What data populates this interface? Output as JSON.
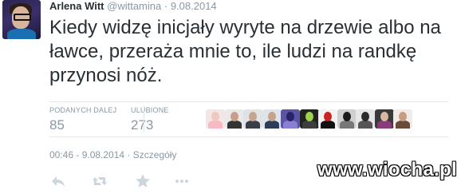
{
  "tweet": {
    "author_name": "Arlena Witt",
    "author_handle": "@wittamina",
    "separator": "·",
    "date": "9.08.2014",
    "text": "Kiedy widzę inicjały wyryte na drzewie albo na ławce, przeraża mnie to, ile ludzi na randkę przynosi nóż."
  },
  "stats": {
    "retweets_label": "PODANYCH DALEJ",
    "retweets_count": "85",
    "favorites_label": "ULUBIONE",
    "favorites_count": "273"
  },
  "favoriters": [
    {
      "name": "favoriter-avatar-1",
      "bg": "#f3e6e6",
      "head": "#f0c8c0",
      "body": "#f7b9c4"
    },
    {
      "name": "favoriter-avatar-2",
      "bg": "#e9e9e9",
      "head": "#c79f86",
      "body": "#333333"
    },
    {
      "name": "favoriter-avatar-3",
      "bg": "#dfe3e7",
      "head": "#c9a48d",
      "body": "#3a3f47"
    },
    {
      "name": "favoriter-avatar-4",
      "bg": "#dde4ea",
      "head": "#c8a28a",
      "body": "#2c3e57"
    },
    {
      "name": "favoriter-avatar-5",
      "bg": "#5b55a5",
      "head": "#2a2366",
      "body": "#8b7fd4"
    },
    {
      "name": "favoriter-avatar-6",
      "bg": "#222222",
      "head": "#9fd24b",
      "body": "#3d3d3d"
    },
    {
      "name": "favoriter-avatar-7",
      "bg": "#f2f2f2",
      "head": "#cc2222",
      "body": "#111111"
    },
    {
      "name": "favoriter-avatar-8",
      "bg": "#cfcfcf",
      "head": "#1a1a1a",
      "body": "#777777"
    },
    {
      "name": "favoriter-avatar-9",
      "bg": "#e6e6e6",
      "head": "#2b2b2b",
      "body": "#555555"
    },
    {
      "name": "favoriter-avatar-10",
      "bg": "#3a3a3a",
      "head": "#d9b8a2",
      "body": "#8a3b7a"
    },
    {
      "name": "favoriter-avatar-11",
      "bg": "#f0ebe8",
      "head": "#c99c82",
      "body": "#6b4a3a"
    }
  ],
  "footer": {
    "time": "00:46 - 9.08.2014",
    "separator": "·",
    "details_link": "Szczegóły"
  },
  "watermark": {
    "text": "www.wiocha.pl"
  },
  "icons": [
    "reply-icon",
    "retweet-icon",
    "favorite-icon",
    "more-icon"
  ],
  "colors": {
    "text": "#292f33",
    "muted": "#8899a6",
    "icon": "#ccd6dd",
    "divider": "#e1e8ed"
  }
}
